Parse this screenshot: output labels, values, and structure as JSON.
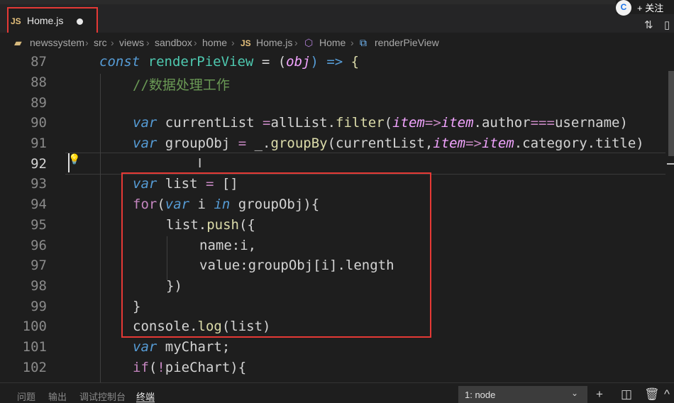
{
  "tab": {
    "lang_badge": "JS",
    "filename": "Home.js"
  },
  "follow": {
    "avatar_text": "C",
    "label": "+ 关注"
  },
  "breadcrumb": {
    "items": [
      "newssystem",
      "src",
      "views",
      "sandbox",
      "home",
      "Home.js",
      "Home",
      "renderPieView"
    ],
    "js_badge": "JS"
  },
  "editor": {
    "line_numbers": [
      "87",
      "88",
      "89",
      "90",
      "91",
      "92",
      "93",
      "94",
      "95",
      "96",
      "97",
      "98",
      "99",
      "100",
      "101",
      "102"
    ],
    "active_line": "92",
    "lines": {
      "l87": {
        "k1": "const",
        "fn": "renderPieView",
        "eq": " = (",
        "p": "obj",
        "arrow": ") => ",
        "brace": "{"
      },
      "l88": {
        "comment": "//数据处理工作"
      },
      "l90": {
        "k": "var",
        "name": " currentList ",
        "eq": "=",
        "obj": "allList.",
        "m": "filter",
        "open": "(",
        "p1": "item",
        "arr": "=>",
        "p2": "item",
        ".author": ".author",
        "op": "===",
        "tail": "username)"
      },
      "l91": {
        "k": "var",
        "name": " groupObj ",
        "eq": "= ",
        "us": "_.",
        "m": "groupBy",
        "open": "(currentList,",
        "p1": "item",
        "arr": "=>",
        "p2": "item",
        "tail": ".category.title)"
      },
      "l93": {
        "k": "var",
        "name": " list ",
        "eq": "= ",
        "tail": "[]"
      },
      "l94": {
        "c": "for",
        "open": "(",
        "k": "var",
        "mid": " i ",
        "in": "in",
        "tail": " groupObj){"
      },
      "l95": {
        "obj": "list.",
        "m": "push",
        "tail": "({"
      },
      "l96": {
        "text": "name:i,"
      },
      "l97": {
        "text": "value:groupObj[i].length"
      },
      "l98": {
        "text": "})"
      },
      "l99": {
        "text": "}"
      },
      "l100": {
        "obj": "console.",
        "m": "log",
        "tail": "(list)"
      },
      "l101": {
        "k": "var",
        "tail": " myChart;"
      },
      "l102": {
        "c": "if",
        "open": "(",
        "op": "!",
        "tail": "pieChart){"
      }
    }
  },
  "panel": {
    "tabs": [
      "问题",
      "输出",
      "调试控制台",
      "终端"
    ],
    "active_tab": "终端",
    "terminal_select": "1: node"
  },
  "colors": {
    "highlight_box": "#e53935",
    "keyword": "#569cd6",
    "control": "#c586c0",
    "function": "#4ec9b0",
    "method": "#dcdcaa",
    "param": "#f2a4ff"
  }
}
